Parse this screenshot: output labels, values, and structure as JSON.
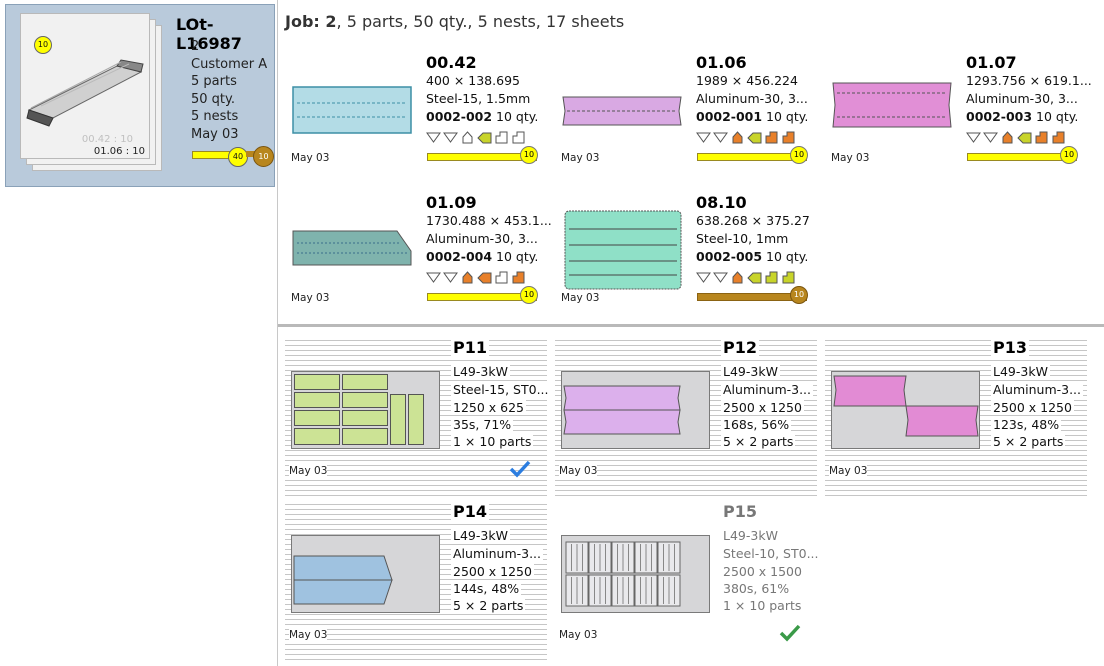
{
  "lot": {
    "title": "LOt-L16987",
    "lines": [
      "2",
      "Customer A",
      "5 parts",
      "50 qty.",
      "5 nests",
      "May 03"
    ],
    "stack_badge": "10",
    "ghost_label": "00.42 : 10",
    "inner_label": "01.06 : 10",
    "progress_badge": "40",
    "count_badge": "10"
  },
  "job": {
    "label": "Job: ",
    "number": "2",
    "summary": ", 5 parts, 50 qty., 5 nests, 17 sheets"
  },
  "parts": [
    {
      "id": "00.42",
      "dims": "400 × 138.695",
      "material": "Steel-15, 1.5mm",
      "code": "0002-002",
      "qty": " 10 qty.",
      "date": "May 03",
      "badge": "10",
      "color": "#b3dce6"
    },
    {
      "id": "01.06",
      "dims": "1989 × 456.224",
      "material": "Aluminum-30, 3...",
      "code": "0002-001",
      "qty": " 10 qty.",
      "date": "May 03",
      "badge": "10",
      "color": "#d9a9e3"
    },
    {
      "id": "01.07",
      "dims": "1293.756 × 619.1...",
      "material": "Aluminum-30, 3...",
      "code": "0002-003",
      "qty": " 10 qty.",
      "date": "May 03",
      "badge": "10",
      "color": "#e18fd6"
    },
    {
      "id": "01.09",
      "dims": "1730.488 × 453.1...",
      "material": "Aluminum-30, 3...",
      "code": "0002-004",
      "qty": " 10 qty.",
      "date": "May 03",
      "badge": "10",
      "color": "#7fb3ad"
    },
    {
      "id": "08.10",
      "dims": "638.268 × 375.27",
      "material": "Steel-10, 1mm",
      "code": "0002-005",
      "qty": " 10 qty.",
      "date": "May 03",
      "badge": "10",
      "color": "#8fe0c7"
    }
  ],
  "nests": [
    {
      "id": "P11",
      "machine": "L49-3kW",
      "material": "Steel-15, ST0...",
      "sheet": "1250 x 625",
      "time": "35s, 71%",
      "parts": "1 × 10 parts",
      "date": "May 03",
      "check_color": "#2b7de0"
    },
    {
      "id": "P12",
      "machine": "L49-3kW",
      "material": "Aluminum-3...",
      "sheet": "2500 x 1250",
      "time": "168s, 56%",
      "parts": "5 × 2 parts",
      "date": "May 03"
    },
    {
      "id": "P13",
      "machine": "L49-3kW",
      "material": "Aluminum-3...",
      "sheet": "2500 x 1250",
      "time": "123s, 48%",
      "parts": "5 × 2 parts",
      "date": "May 03"
    },
    {
      "id": "P14",
      "machine": "L49-3kW",
      "material": "Aluminum-3...",
      "sheet": "2500 x 1250",
      "time": "144s, 48%",
      "parts": "5 × 2 parts",
      "date": "May 03"
    },
    {
      "id": "P15",
      "machine": "L49-3kW",
      "material": "Steel-10, ST0...",
      "sheet": "2500 x 1500",
      "time": "380s, 61%",
      "parts": "1 × 10 parts",
      "date": "May 03",
      "check_color": "#3a9a48"
    }
  ],
  "colors": {
    "selection": "#b9cadb",
    "progress": "#ffff00",
    "progress_done": "#b8861e"
  }
}
